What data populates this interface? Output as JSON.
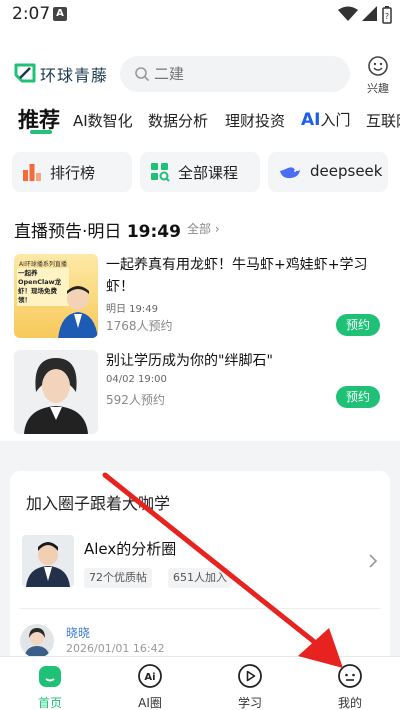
{
  "status": {
    "time": "2:07",
    "badge": "A"
  },
  "header": {
    "logo_text": "环球青藤",
    "search_placeholder": "二建",
    "interest_label": "兴趣"
  },
  "categories": [
    {
      "label": "推荐",
      "active": true
    },
    {
      "label": "AI数智化"
    },
    {
      "label": "数据分析"
    },
    {
      "label": "理财投资"
    },
    {
      "label": "AI入门",
      "ai_prefix": "AI",
      "rest": "入门"
    },
    {
      "label": "互联网"
    }
  ],
  "quick_links": [
    {
      "label": "排行榜",
      "icon": "ranking-icon"
    },
    {
      "label": "全部课程",
      "icon": "courses-icon"
    },
    {
      "label": "deepseek",
      "icon": "whale-icon"
    }
  ],
  "live_section": {
    "title_prefix": "直播预告·明日",
    "title_time": "19:49",
    "all_label": "全部 ›",
    "items": [
      {
        "title": "一起养真有用龙虾！牛马虾+鸡娃虾+学习虾！",
        "date": "明日 19:49",
        "count": "1768人预约",
        "button": "预约",
        "thumb_top": "AI环球播系列直播",
        "thumb_banner": "一起养OpenClaw龙虾！现场免费领！"
      },
      {
        "title": "别让学历成为你的\"绊脚石\"",
        "date": "04/02 19:00",
        "count": "592人预约",
        "button": "预约"
      }
    ]
  },
  "circle": {
    "title": "加入圈子跟着大咖学",
    "name": "Alex的分析圈",
    "posts": "72个优质帖",
    "members": "651人加入",
    "post_author": "晓晓",
    "post_time": "2026/01/01 16:42"
  },
  "bottom_nav": [
    {
      "label": "首页",
      "icon": "home-icon",
      "active": true
    },
    {
      "label": "AI圈",
      "icon": "ai-circle-icon"
    },
    {
      "label": "学习",
      "icon": "play-icon"
    },
    {
      "label": "我的",
      "icon": "profile-icon"
    }
  ],
  "colors": {
    "accent": "#1fc177",
    "ai_blue": "#1e5ee8",
    "annotation_arrow": "#e8231f"
  }
}
